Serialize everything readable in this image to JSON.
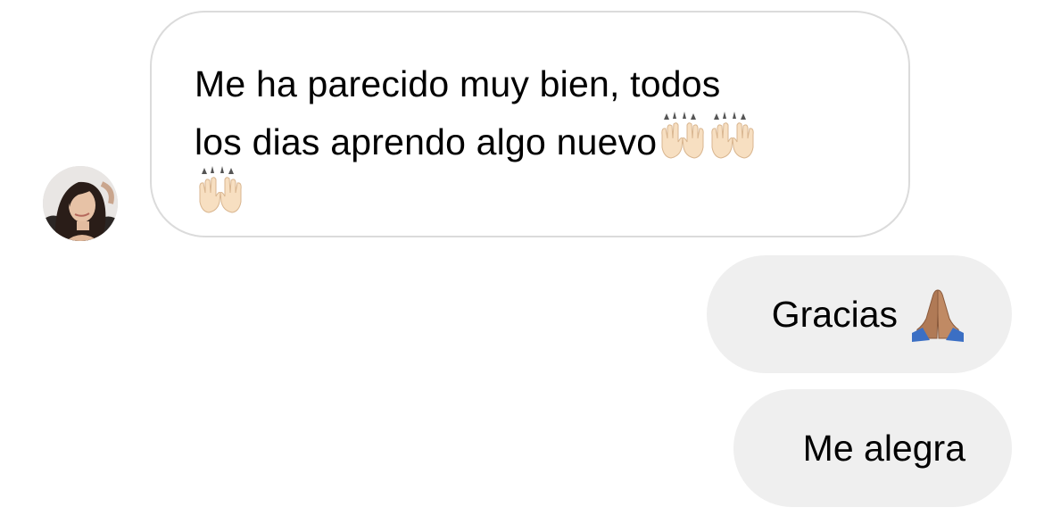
{
  "conversation": {
    "incoming": {
      "text": "Me ha parecido muy bien, todos\nlos dias aprendo algo nuevo",
      "emojis": [
        "raising-hands",
        "raising-hands",
        "raising-hands"
      ]
    },
    "outgoing": [
      {
        "text": "Gracias",
        "emoji": "folded-hands"
      },
      {
        "text": "Me alegra"
      }
    ]
  },
  "colors": {
    "incoming_border": "#dbdbdb",
    "outgoing_bubble": "#efefef",
    "text": "#000000"
  }
}
